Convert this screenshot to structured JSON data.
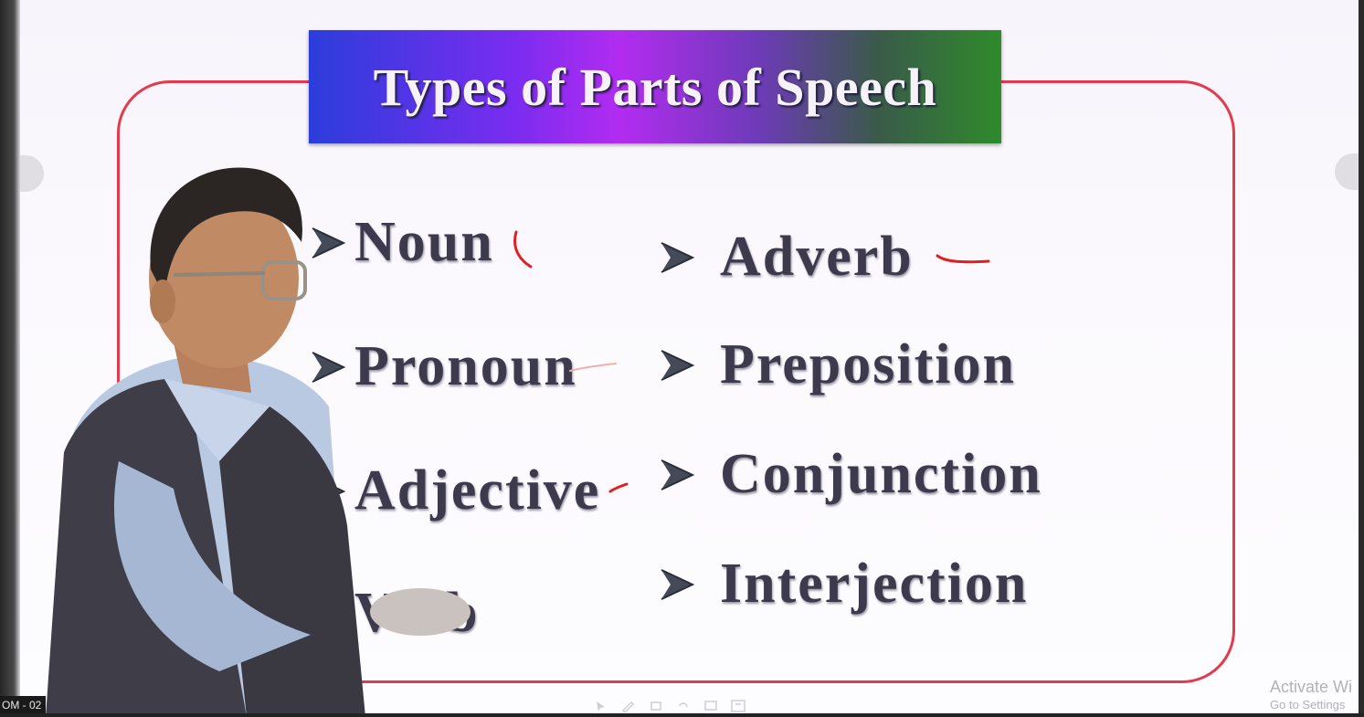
{
  "slide": {
    "title": "Types of Parts of Speech",
    "left_column": [
      "Noun",
      "Pronoun",
      "Adjective",
      "Verb"
    ],
    "right_column": [
      "Adverb",
      "Preposition",
      "Conjunction",
      "Interjection"
    ],
    "bullet_icon": "arrow-bullet-icon",
    "colors": {
      "frame_border": "#e43a4e",
      "title_gradient_start": "#2c3ddb",
      "title_gradient_mid": "#b22cf0",
      "title_gradient_end": "#2f8a2c",
      "item_text": "#3c3a4c",
      "annotation_ink": "#e02020"
    }
  },
  "overlay": {
    "session_label": "OM - 02",
    "watermark_title": "Activate Wi",
    "watermark_sub": "Go to Settings"
  }
}
